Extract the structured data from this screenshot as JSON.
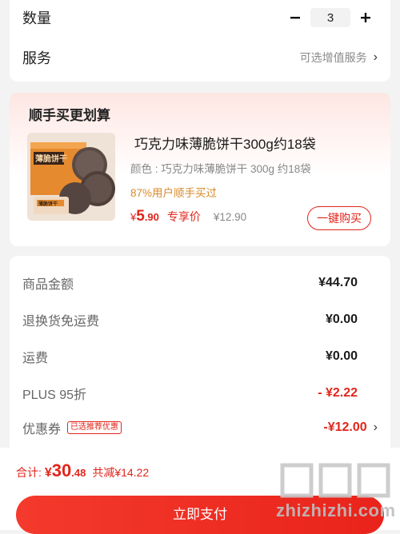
{
  "quantity": {
    "label": "数量",
    "value": "3",
    "minus_icon": "minus-icon",
    "plus_icon": "plus-icon"
  },
  "service": {
    "label": "服务",
    "hint": "可选增值服务"
  },
  "bundle": {
    "title": "顺手买更划算",
    "product": {
      "name": "巧克力味薄脆饼干300g约18袋",
      "color_text": "颜色 : 巧克力味薄脆饼干 300g 约18袋",
      "buy_rate": "87%用户顺手买过",
      "price_symbol": "¥",
      "price_int": "5",
      "price_dec": ".90",
      "exclusive_tag": "专享价",
      "original_price": "¥12.90",
      "buy_button": "一键购买",
      "image_text": "薄脆饼干",
      "image_text2": "薄脆饼干"
    }
  },
  "summary": {
    "rows": [
      {
        "label": "商品金额",
        "value": "¥44.70"
      },
      {
        "label": "退换货免运费",
        "value": "¥0.00"
      },
      {
        "label": "运费",
        "value": "¥0.00"
      },
      {
        "label": "PLUS 95折",
        "value": "- ¥2.22"
      },
      {
        "label": "优惠券",
        "badge": "已选推荐优惠",
        "value": "-¥12.00"
      }
    ]
  },
  "footer": {
    "total_label": "合计:",
    "total_symbol": "¥",
    "total_int": "30",
    "total_dec": ".48",
    "reduce_text": "共减¥14.22",
    "pay_button": "立即支付"
  },
  "watermark": {
    "text": "zhizhizhi.com"
  },
  "colors": {
    "accent": "#e1251b",
    "orange": "#d88a2a",
    "bg": "#f3f3f3"
  }
}
